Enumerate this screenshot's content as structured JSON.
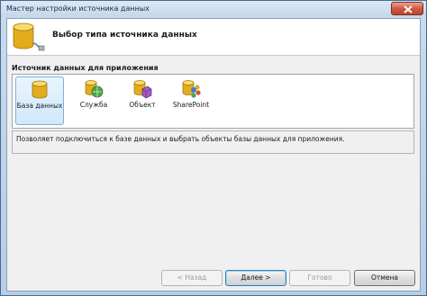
{
  "window": {
    "title": "Мастер настройки источника данных"
  },
  "header": {
    "title": "Выбор типа источника данных"
  },
  "section": {
    "label": "Источник данных для приложения"
  },
  "data_source_types": [
    {
      "label": "База данных",
      "icon": "database-icon",
      "selected": true
    },
    {
      "label": "Служба",
      "icon": "service-icon",
      "selected": false
    },
    {
      "label": "Объект",
      "icon": "object-icon",
      "selected": false
    },
    {
      "label": "SharePoint",
      "icon": "sharepoint-icon",
      "selected": false
    }
  ],
  "description": {
    "text": "Позволяет подключиться к базе данных и выбрать объекты базы данных для приложения."
  },
  "buttons": {
    "back": "< Назад",
    "next": "Далее >",
    "finish": "Готово",
    "cancel": "Отмена"
  },
  "colors": {
    "close_button": "#cf5a43",
    "selection": "#cfe8fb",
    "database_icon": "#e8b622"
  }
}
